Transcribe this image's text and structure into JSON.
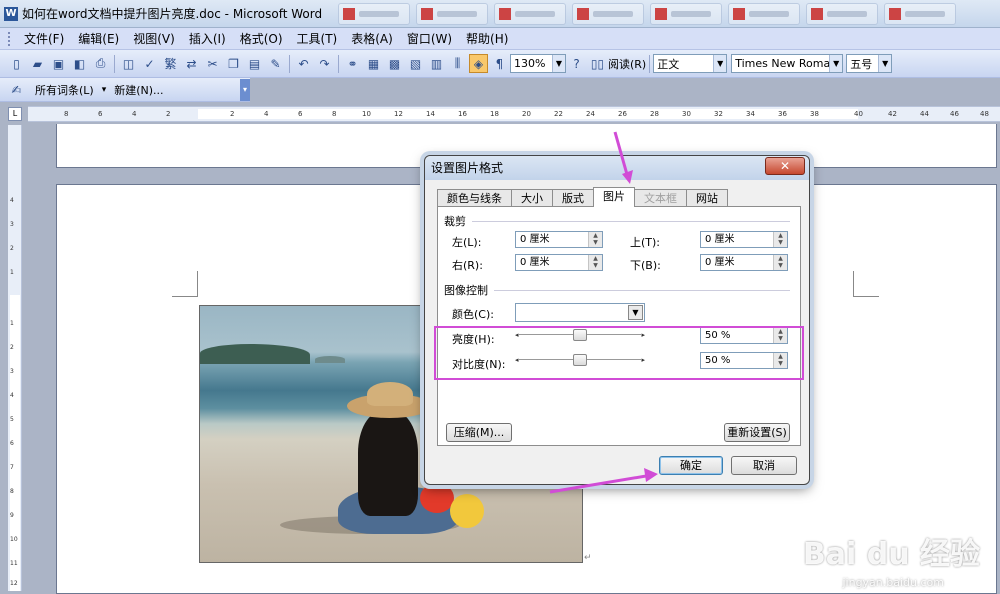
{
  "window": {
    "title": "如何在word文档中提升图片亮度.doc - Microsoft Word"
  },
  "menubar": {
    "items": [
      "文件(F)",
      "编辑(E)",
      "视图(V)",
      "插入(I)",
      "格式(O)",
      "工具(T)",
      "表格(A)",
      "窗口(W)",
      "帮助(H)"
    ]
  },
  "toolbar": {
    "zoom": "130%",
    "read_label": "阅读(R)",
    "style": "正文",
    "font": "Times New Roman",
    "size": "五号"
  },
  "toolbar2": {
    "entries_label": "所有词条(L)",
    "new_label": "新建(N)..."
  },
  "ruler": {
    "ticks": [
      "8",
      "6",
      "4",
      "2",
      "2",
      "4",
      "6",
      "8",
      "10",
      "12",
      "14",
      "16",
      "18",
      "20",
      "22",
      "24",
      "26",
      "28",
      "30",
      "32",
      "34",
      "36",
      "38",
      "40",
      "42",
      "44",
      "46",
      "48"
    ],
    "vticks": [
      "4",
      "3",
      "2",
      "1",
      "1",
      "2",
      "3",
      "4",
      "5",
      "6",
      "7",
      "8",
      "9",
      "10",
      "11",
      "12",
      "13",
      "14"
    ]
  },
  "dialog": {
    "title": "设置图片格式",
    "close": "✕",
    "tabs": [
      "颜色与线条",
      "大小",
      "版式",
      "图片",
      "文本框",
      "网站"
    ],
    "active_tab": "图片",
    "crop": {
      "label": "裁剪",
      "left_label": "左(L):",
      "left_value": "0 厘米",
      "top_label": "上(T):",
      "top_value": "0 厘米",
      "right_label": "右(R):",
      "right_value": "0 厘米",
      "bottom_label": "下(B):",
      "bottom_value": "0 厘米"
    },
    "image_control": {
      "label": "图像控制",
      "color_label": "颜色(C):",
      "color_value": "",
      "brightness_label": "亮度(H):",
      "brightness_value": "50 %",
      "brightness_level": 0.5,
      "contrast_label": "对比度(N):",
      "contrast_value": "50 %",
      "contrast_level": 0.5
    },
    "compress_button": "压缩(M)...",
    "reset_button": "重新设置(S)",
    "ok_button": "确定",
    "cancel_button": "取消"
  },
  "watermark": {
    "brand": "Bai du 经验",
    "url": "jingyan.baidu.com"
  },
  "colors": {
    "highlight": "#d14cd6",
    "menubar": "#d6dff7"
  }
}
